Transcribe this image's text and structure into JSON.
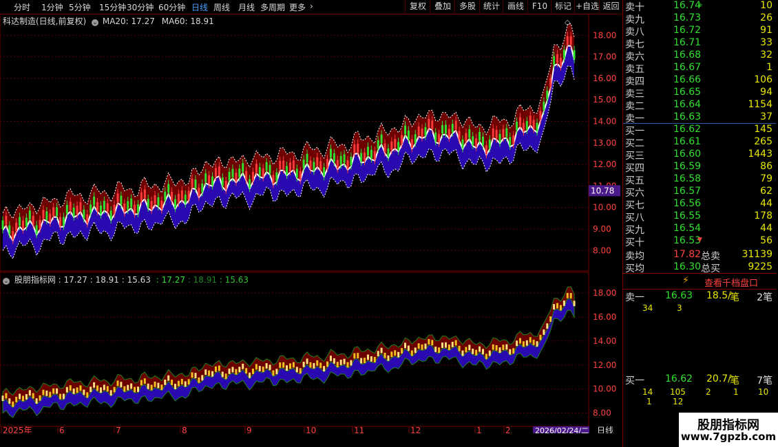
{
  "toolbar": {
    "periods": [
      "分时",
      "1分钟",
      "5分钟",
      "15分钟",
      "30分钟",
      "60分钟",
      "日线",
      "周线",
      "月线",
      "多周期",
      "更多"
    ],
    "active_period": "日线",
    "buttons": [
      "复权",
      "叠加",
      "多股",
      "统计",
      "画线",
      "F10",
      "标记",
      "+自选",
      "返回"
    ]
  },
  "main_chart": {
    "title": "科达制造(日线,前复权)",
    "ma20_label": "MA20: 17.27",
    "ma60_label": "MA60: 18.91",
    "price_ticks": [
      "18.00",
      "17.00",
      "16.00",
      "15.00",
      "14.00",
      "13.00",
      "12.00",
      "11.00",
      "10.00",
      "9.00",
      "8.00"
    ],
    "current_price_tag": "10.78"
  },
  "sub_chart": {
    "title": "股朋指标网",
    "values_plain": ": 17.27 : 18.91 : 15.63",
    "value_a": ": 17.27",
    "value_b": ": 18.91",
    "value_c": ": 15.63",
    "ticks": [
      "18.00",
      "16.00",
      "14.00",
      "12.00",
      "10.00",
      "8.00"
    ]
  },
  "x_axis": {
    "labels": [
      "2025年",
      "6",
      "7",
      "8",
      "9",
      "10",
      "11",
      "12",
      "1",
      "2"
    ],
    "cursor_date": "2026/02/24/二",
    "period_label": "日线"
  },
  "colors": {
    "up": "#ff3a3a",
    "down": "#30e030",
    "band_upper": "#6e0000",
    "band_lower": "#2a0ab0",
    "ma_line": "#ffffff",
    "yellow": "#f0c020",
    "grid": "#5a0000"
  },
  "quote": {
    "asks": [
      {
        "label": "卖十",
        "price": "16.74",
        "vol": "10"
      },
      {
        "label": "卖九",
        "price": "16.73",
        "vol": "26"
      },
      {
        "label": "卖八",
        "price": "16.72",
        "vol": "91"
      },
      {
        "label": "卖七",
        "price": "16.71",
        "vol": "33"
      },
      {
        "label": "卖六",
        "price": "16.68",
        "vol": "32"
      },
      {
        "label": "卖五",
        "price": "16.67",
        "vol": "1"
      },
      {
        "label": "卖四",
        "price": "16.66",
        "vol": "106"
      },
      {
        "label": "卖三",
        "price": "16.65",
        "vol": "94"
      },
      {
        "label": "卖二",
        "price": "16.64",
        "vol": "1154"
      },
      {
        "label": "卖一",
        "price": "16.63",
        "vol": "37"
      }
    ],
    "bids": [
      {
        "label": "买一",
        "price": "16.62",
        "vol": "145"
      },
      {
        "label": "买二",
        "price": "16.61",
        "vol": "265"
      },
      {
        "label": "买三",
        "price": "16.60",
        "vol": "1443"
      },
      {
        "label": "买四",
        "price": "16.59",
        "vol": "86"
      },
      {
        "label": "买五",
        "price": "16.58",
        "vol": "79"
      },
      {
        "label": "买六",
        "price": "16.57",
        "vol": "62"
      },
      {
        "label": "买七",
        "price": "16.56",
        "vol": "44"
      },
      {
        "label": "买八",
        "price": "16.55",
        "vol": "178"
      },
      {
        "label": "买九",
        "price": "16.54",
        "vol": "44"
      },
      {
        "label": "买十",
        "price": "16.53",
        "vol": "56"
      }
    ],
    "ask_avg_label": "卖均",
    "ask_avg": "17.82",
    "ask_total_label": "总卖",
    "ask_total": "31139",
    "bid_avg_label": "买均",
    "bid_avg": "16.30",
    "bid_total_label": "总买",
    "bid_total": "9225",
    "thousand_button": "查看千档盘口",
    "sell1": {
      "label": "卖一",
      "price": "16.63",
      "per": "18.5/",
      "unit": "笔",
      "count": "2笔",
      "orders": [
        "34",
        "3"
      ]
    },
    "buy1": {
      "label": "买一",
      "price": "16.62",
      "per": "20.7/",
      "unit": "笔",
      "count": "7笔",
      "orders_row1": [
        "14",
        "105",
        "2",
        "1",
        "10"
      ],
      "orders_row2": [
        "1",
        "12"
      ]
    }
  },
  "watermark": {
    "line1": "股朋指标网",
    "line2": "www.7gpzb.com"
  }
}
